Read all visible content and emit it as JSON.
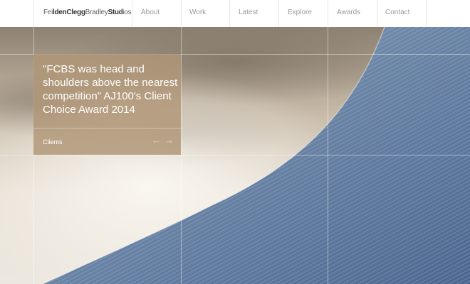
{
  "header": {
    "logo": {
      "feilden_a": "Fei",
      "feilden_b": "lden",
      "clegg": "Clegg",
      "bradley": "Bradley",
      "studios_a": "Stud",
      "studios_b": "ios"
    },
    "nav": [
      {
        "label": "About"
      },
      {
        "label": "Work"
      },
      {
        "label": "Latest"
      },
      {
        "label": "Explore"
      },
      {
        "label": "Awards"
      },
      {
        "label": "Contact"
      }
    ]
  },
  "hero": {
    "quote": "\"FCBS was head and shoulders above the nearest competition\" AJ100's Client Choice Award 2014",
    "link_label": "Clients",
    "prev_icon": "arrow-left-icon",
    "next_icon": "arrow-right-icon"
  },
  "colors": {
    "panel": "#b09676",
    "roof": "#5f7b9e",
    "nav_text": "#9a9a9a"
  }
}
